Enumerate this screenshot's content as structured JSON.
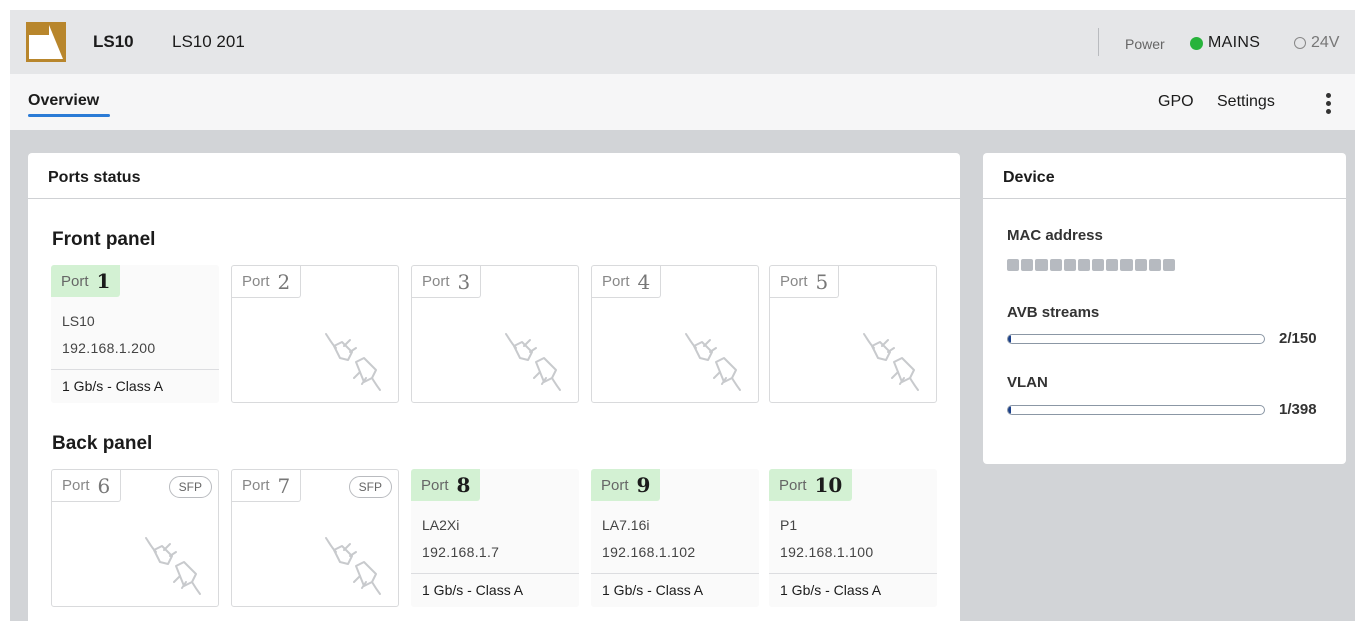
{
  "header": {
    "device_name": "LS10",
    "device_model": "LS10 201",
    "power_label": "Power",
    "power_sources": [
      {
        "label": "MAINS",
        "active": true,
        "color": "#27b33b"
      },
      {
        "label": "24V",
        "active": false,
        "color": "#888888"
      }
    ]
  },
  "nav": {
    "tabs": [
      {
        "label": "Overview",
        "active": true
      }
    ],
    "gpo": "GPO",
    "settings": "Settings"
  },
  "ports_card": {
    "title": "Ports status",
    "front_title": "Front panel",
    "back_title": "Back panel",
    "port_label": "Port",
    "sfp_label": "SFP",
    "front_ports": [
      {
        "number": "1",
        "connected": true,
        "device": "LS10",
        "ip": "192.168.1.200",
        "speed": "1 Gb/s - Class A"
      },
      {
        "number": "2",
        "connected": false
      },
      {
        "number": "3",
        "connected": false
      },
      {
        "number": "4",
        "connected": false
      },
      {
        "number": "5",
        "connected": false
      }
    ],
    "back_ports": [
      {
        "number": "6",
        "connected": false,
        "sfp": true
      },
      {
        "number": "7",
        "connected": false,
        "sfp": true
      },
      {
        "number": "8",
        "connected": true,
        "device": "LA2Xi",
        "ip": "192.168.1.7",
        "speed": "1 Gb/s - Class A"
      },
      {
        "number": "9",
        "connected": true,
        "device": "LA7.16i",
        "ip": "192.168.1.102",
        "speed": "1 Gb/s - Class A"
      },
      {
        "number": "10",
        "connected": true,
        "device": "P1",
        "ip": "192.168.1.100",
        "speed": "1 Gb/s - Class A"
      }
    ]
  },
  "device_card": {
    "title": "Device",
    "mac_label": "MAC address",
    "avb_label": "AVB streams",
    "avb_value": "2/150",
    "avb_used": 2,
    "avb_total": 150,
    "vlan_label": "VLAN",
    "vlan_value": "1/398",
    "vlan_used": 1,
    "vlan_total": 398
  },
  "colors": {
    "accent": "#2b7bd6",
    "active_port_tag": "#d3f1d3",
    "bar_fill": "#1a3f88",
    "logo": "#b8862c"
  }
}
